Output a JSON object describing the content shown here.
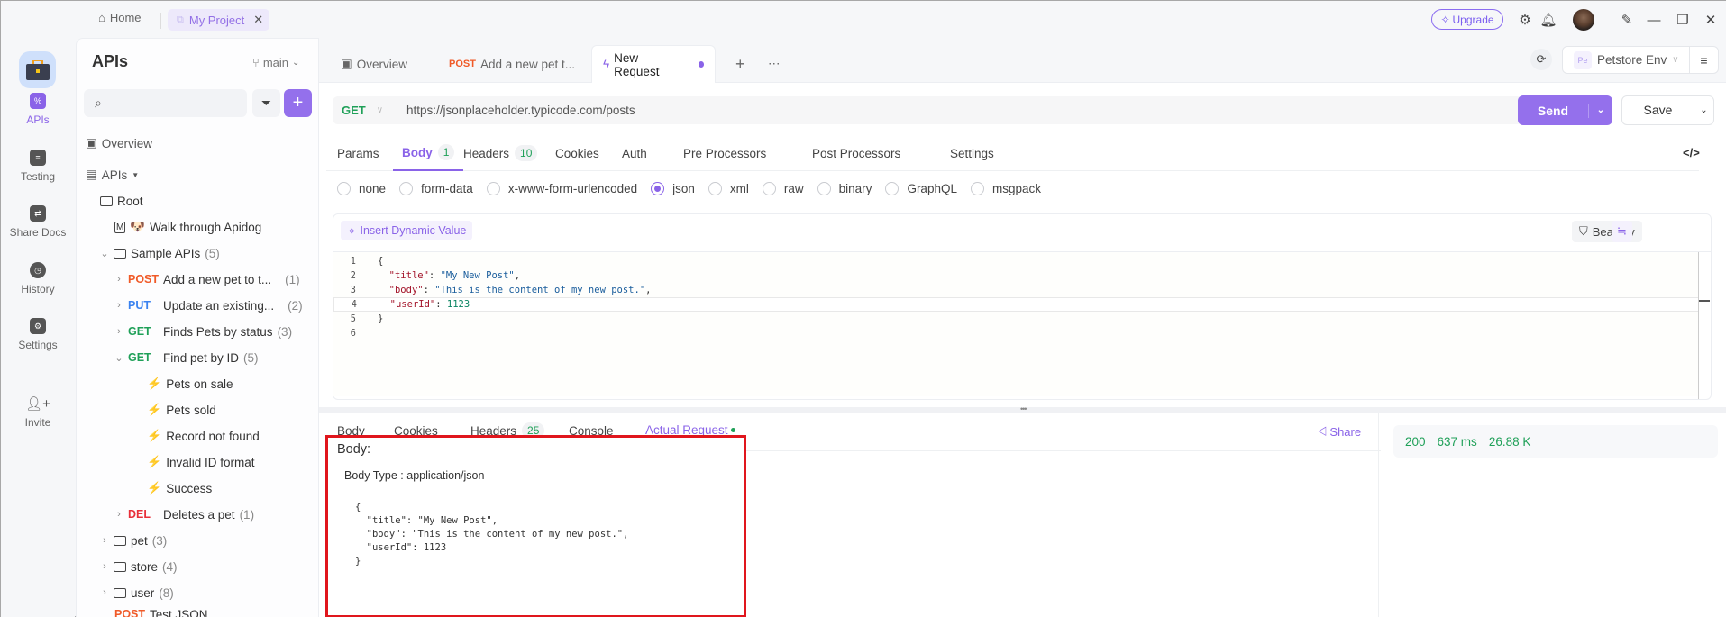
{
  "titlebar": {
    "home_label": "Home",
    "project_tab_label": "My Project",
    "upgrade_label": "Upgrade"
  },
  "rail": {
    "items": [
      {
        "label": "APIs",
        "icon": "apis-icon",
        "active": true
      },
      {
        "label": "Testing",
        "icon": "testing-icon"
      },
      {
        "label": "Share Docs",
        "icon": "share-docs-icon"
      },
      {
        "label": "History",
        "icon": "history-icon"
      },
      {
        "label": "Settings",
        "icon": "settings-icon"
      },
      {
        "label": "Invite",
        "icon": "invite-icon"
      }
    ]
  },
  "sidebar": {
    "title": "APIs",
    "branch": "main",
    "search_placeholder": "",
    "overview_label": "Overview",
    "apis_label": "APIs",
    "root_label": "Root",
    "walkthrough_label": "Walk through Apidog",
    "sample_apis": {
      "label": "Sample APIs",
      "count": "(5)"
    },
    "endpoints": [
      {
        "method": "POST",
        "label": "Add a new pet to t...",
        "count": "(1)"
      },
      {
        "method": "PUT",
        "label": "Update an existing...",
        "count": "(2)"
      },
      {
        "method": "GET",
        "label": "Finds Pets by status",
        "count": "(3)"
      },
      {
        "method": "GET",
        "label": "Find pet by ID",
        "count": "(5)"
      },
      {
        "method": "DEL",
        "label": "Deletes a pet",
        "count": "(1)"
      }
    ],
    "cases": [
      "Pets on sale",
      "Pets sold",
      "Record not found",
      "Invalid ID format",
      "Success"
    ],
    "folders": [
      {
        "label": "pet",
        "count": "(3)"
      },
      {
        "label": "store",
        "count": "(4)"
      },
      {
        "label": "user",
        "count": "(8)"
      }
    ],
    "last_item": {
      "method": "POST",
      "label": "Test JSON"
    }
  },
  "tabs": {
    "overview": "Overview",
    "post_tab": {
      "method": "POST",
      "label": "Add a new pet t..."
    },
    "active_tab": "New Request"
  },
  "environment": {
    "badge": "Pe",
    "label": "Petstore Env"
  },
  "request": {
    "method": "GET",
    "url": "https://jsonplaceholder.typicode.com/posts",
    "send_label": "Send",
    "save_label": "Save"
  },
  "request_tabs": [
    {
      "label": "Params"
    },
    {
      "label": "Body",
      "badge": "1",
      "active": true
    },
    {
      "label": "Headers",
      "badge": "10"
    },
    {
      "label": "Cookies"
    },
    {
      "label": "Auth"
    },
    {
      "label": "Pre Processors"
    },
    {
      "label": "Post Processors"
    },
    {
      "label": "Settings"
    }
  ],
  "body_types": [
    "none",
    "form-data",
    "x-www-form-urlencoded",
    "json",
    "xml",
    "raw",
    "binary",
    "GraphQL",
    "msgpack"
  ],
  "body_type_selected": "json",
  "editor": {
    "insert_label": "Insert Dynamic Value",
    "beautify_label": "Beautify",
    "line_numbers": [
      "1",
      "2",
      "3",
      "4",
      "5",
      "6"
    ],
    "title_key": "\"title\"",
    "title_val": "\"My New Post\"",
    "body_key": "\"body\"",
    "body_val": "\"This is the content of my new post.\"",
    "userid_key": "\"userId\"",
    "userid_val": "1123"
  },
  "response_tabs": [
    {
      "label": "Body"
    },
    {
      "label": "Cookies"
    },
    {
      "label": "Headers",
      "badge": "25"
    },
    {
      "label": "Console"
    },
    {
      "label": "Actual Request",
      "active": true
    }
  ],
  "share_label": "Share",
  "response_status": {
    "code": "200",
    "time": "637 ms",
    "size": "26.88 K"
  },
  "actual_request": {
    "title": "Body:",
    "body_type": "Body Type : application/json",
    "code_lines": [
      "{",
      "  \"title\": \"My New Post\",",
      "  \"body\": \"This is the content of my new post.\",",
      "  \"userId\": 1123",
      "}"
    ]
  },
  "colors": {
    "accent": "#9470ec",
    "get": "#1fa058",
    "post": "#f05a28",
    "put": "#3a82f0",
    "del": "#e8303a",
    "highlight_box": "#e0161d"
  }
}
